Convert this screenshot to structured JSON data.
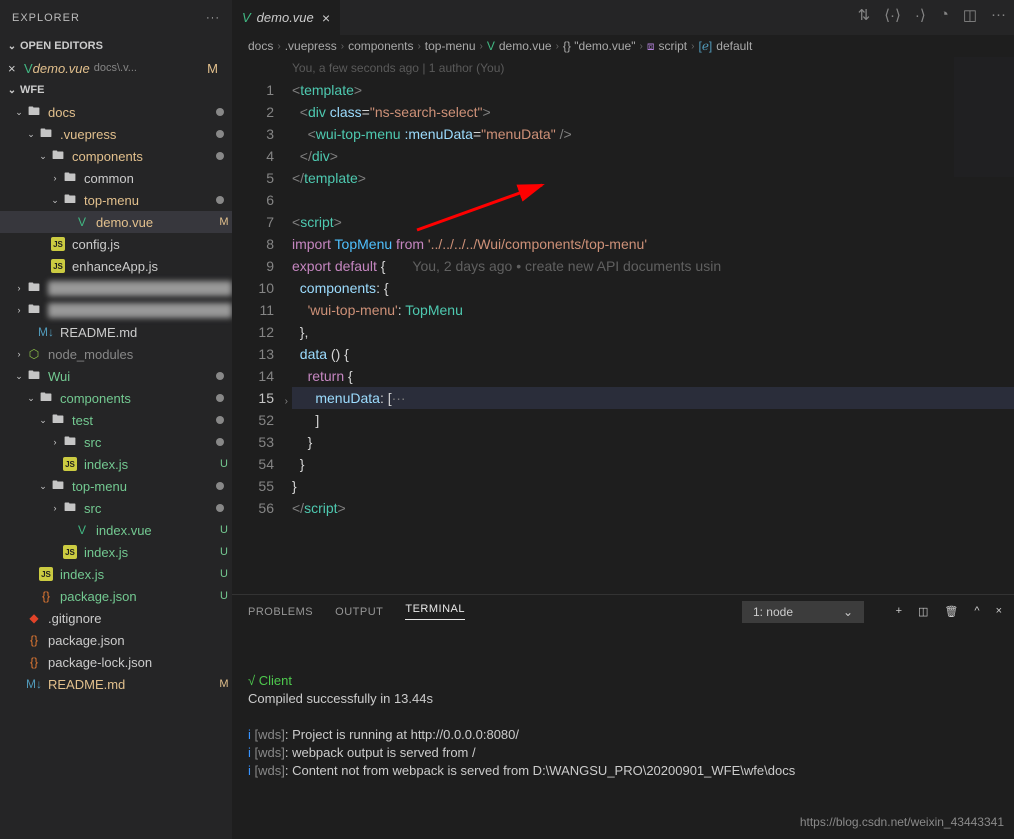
{
  "explorer": {
    "title": "EXPLORER",
    "open_editors_label": "OPEN EDITORS",
    "workspace_label": "WFE",
    "open_file": {
      "name": "demo.vue",
      "path": "docs\\.v...",
      "badge": "M"
    }
  },
  "tree": [
    {
      "depth": 1,
      "type": "folder",
      "open": true,
      "name": "docs",
      "dot": true,
      "textClass": "modified-text"
    },
    {
      "depth": 2,
      "type": "folder",
      "open": true,
      "name": ".vuepress",
      "dot": true,
      "textClass": "modified-text"
    },
    {
      "depth": 3,
      "type": "folder",
      "open": true,
      "name": "components",
      "dot": true,
      "textClass": "modified-text"
    },
    {
      "depth": 4,
      "type": "folder",
      "open": false,
      "name": "common"
    },
    {
      "depth": 4,
      "type": "folder",
      "open": true,
      "name": "top-menu",
      "dot": true,
      "textClass": "modified-text"
    },
    {
      "depth": 5,
      "type": "file",
      "icon": "vue",
      "name": "demo.vue",
      "badge": "M",
      "badgeClass": "git-m",
      "active": true,
      "textClass": "modified-text"
    },
    {
      "depth": 3,
      "type": "file",
      "icon": "js",
      "name": "config.js"
    },
    {
      "depth": 3,
      "type": "file",
      "icon": "js",
      "name": "enhanceApp.js"
    },
    {
      "depth": 1,
      "type": "folder",
      "open": false,
      "name": "blurred1",
      "blurred": true
    },
    {
      "depth": 1,
      "type": "folder",
      "open": false,
      "name": "blurred2",
      "blurred": true
    },
    {
      "depth": 2,
      "type": "file",
      "icon": "md",
      "name": "README.md"
    },
    {
      "depth": 1,
      "type": "folder",
      "open": false,
      "name": "node_modules",
      "icon": "nm",
      "textClass": "t-gray"
    },
    {
      "depth": 1,
      "type": "folder",
      "open": true,
      "name": "Wui",
      "dot": true,
      "textClass": "git-text"
    },
    {
      "depth": 2,
      "type": "folder",
      "open": true,
      "name": "components",
      "dot": true,
      "textClass": "git-text"
    },
    {
      "depth": 3,
      "type": "folder",
      "open": true,
      "name": "test",
      "dot": true,
      "textClass": "git-text"
    },
    {
      "depth": 4,
      "type": "folder",
      "open": false,
      "name": "src",
      "dot": true,
      "textClass": "git-text"
    },
    {
      "depth": 4,
      "type": "file",
      "icon": "js",
      "name": "index.js",
      "badge": "U",
      "badgeClass": "git-u",
      "textClass": "git-text"
    },
    {
      "depth": 3,
      "type": "folder",
      "open": true,
      "name": "top-menu",
      "dot": true,
      "textClass": "git-text"
    },
    {
      "depth": 4,
      "type": "folder",
      "open": false,
      "name": "src",
      "dot": true,
      "textClass": "git-text"
    },
    {
      "depth": 5,
      "type": "file",
      "icon": "vue",
      "name": "index.vue",
      "badge": "U",
      "badgeClass": "git-u",
      "textClass": "git-text"
    },
    {
      "depth": 4,
      "type": "file",
      "icon": "js",
      "name": "index.js",
      "badge": "U",
      "badgeClass": "git-u",
      "textClass": "git-text"
    },
    {
      "depth": 2,
      "type": "file",
      "icon": "js",
      "name": "index.js",
      "badge": "U",
      "badgeClass": "git-u",
      "textClass": "git-text"
    },
    {
      "depth": 2,
      "type": "file",
      "icon": "json",
      "name": "package.json",
      "badge": "U",
      "badgeClass": "git-u",
      "textClass": "git-text"
    },
    {
      "depth": 1,
      "type": "file",
      "icon": "git",
      "name": ".gitignore"
    },
    {
      "depth": 1,
      "type": "file",
      "icon": "json",
      "name": "package.json"
    },
    {
      "depth": 1,
      "type": "file",
      "icon": "json",
      "name": "package-lock.json"
    },
    {
      "depth": 1,
      "type": "file",
      "icon": "md",
      "name": "README.md",
      "badge": "M",
      "badgeClass": "git-m",
      "textClass": "modified-text"
    }
  ],
  "tab": {
    "name": "demo.vue"
  },
  "breadcrumb": [
    "docs",
    ".vuepress",
    "components",
    "top-menu",
    "demo.vue",
    "{} \"demo.vue\"",
    "script",
    "default"
  ],
  "blame_header": "You, a few seconds ago | 1 author (You)",
  "inline_blame": "You, 2 days ago • create new API documents usin",
  "code_lines": [
    {
      "n": 1,
      "html": "<span class='tk-tag'>&lt;</span><span class='tk-name'>template</span><span class='tk-tag'>&gt;</span>"
    },
    {
      "n": 2,
      "html": "  <span class='tk-tag'>&lt;</span><span class='tk-name'>div</span> <span class='tk-attr'>class</span><span class='tk-punc'>=</span><span class='tk-str'>\"ns-search-select\"</span><span class='tk-tag'>&gt;</span>"
    },
    {
      "n": 3,
      "html": "    <span class='tk-tag'>&lt;</span><span class='tk-name'>wui-top-menu</span> <span class='tk-attr'>:menuData</span><span class='tk-punc'>=</span><span class='tk-str'>\"menuData\"</span> <span class='tk-tag'>/&gt;</span>"
    },
    {
      "n": 4,
      "html": "  <span class='tk-tag'>&lt;/</span><span class='tk-name'>div</span><span class='tk-tag'>&gt;</span>"
    },
    {
      "n": 5,
      "html": "<span class='tk-tag'>&lt;/</span><span class='tk-name'>template</span><span class='tk-tag'>&gt;</span>"
    },
    {
      "n": 6,
      "html": ""
    },
    {
      "n": 7,
      "html": "<span class='tk-tag'>&lt;</span><span class='tk-name'>script</span><span class='tk-tag'>&gt;</span>"
    },
    {
      "n": 8,
      "html": "<span class='tk-kw'>import</span> <span class='tk-var'>TopMenu</span> <span class='tk-kw'>from</span> <span class='tk-str'>'../../../../Wui/components/top-menu'</span>",
      "mod": true
    },
    {
      "n": 9,
      "html": "<span class='tk-kw'>export</span> <span class='tk-kw'>default</span> <span class='tk-punc'>{</span>       <span class='tk-blame'>{{BLAME}}</span>"
    },
    {
      "n": 10,
      "html": "  <span class='tk-prop'>components</span><span class='tk-punc'>: {</span>"
    },
    {
      "n": 11,
      "html": "    <span class='tk-str'>'wui-top-menu'</span><span class='tk-punc'>:</span> <span class='tk-type'>TopMenu</span>"
    },
    {
      "n": 12,
      "html": "  <span class='tk-punc'>},</span>"
    },
    {
      "n": 13,
      "html": "  <span class='tk-prop'>data</span> <span class='tk-punc'>() {</span>"
    },
    {
      "n": 14,
      "html": "    <span class='tk-kw'>return</span> <span class='tk-punc'>{</span>"
    },
    {
      "n": 15,
      "html": "      <span class='tk-prop'>menuData</span><span class='tk-punc'>: [</span><span class='tk-tag'>···</span>",
      "hl": true,
      "fold": true
    },
    {
      "n": 52,
      "html": "      <span class='tk-punc'>]</span>"
    },
    {
      "n": 53,
      "html": "    <span class='tk-punc'>}</span>"
    },
    {
      "n": 54,
      "html": "  <span class='tk-punc'>}</span>"
    },
    {
      "n": 55,
      "html": "<span class='tk-punc'>}</span>"
    },
    {
      "n": 56,
      "html": "<span class='tk-tag'>&lt;/</span><span class='tk-name'>script</span><span class='tk-tag'>&gt;</span>"
    }
  ],
  "panel": {
    "tabs": [
      "PROBLEMS",
      "OUTPUT",
      "TERMINAL"
    ],
    "active_tab": "TERMINAL",
    "select": "1: node"
  },
  "terminal_lines": [
    {
      "html": "<span class='t-green'>√</span> <span class='t-green'>Client</span>"
    },
    {
      "html": "  Compiled successfully in 13.44s"
    },
    {
      "html": ""
    },
    {
      "html": "<span class='t-cyan'>i</span> <span class='t-gray'>[wds]</span>: Project is running at http://0.0.0.0:8080/"
    },
    {
      "html": "<span class='t-cyan'>i</span> <span class='t-gray'>[wds]</span>: webpack output is served from /"
    },
    {
      "html": "<span class='t-cyan'>i</span> <span class='t-gray'>[wds]</span>: Content not from webpack is served from D:\\WANGSU_PRO\\20200901_WFE\\wfe\\docs"
    }
  ],
  "watermark": "https://blog.csdn.net/weixin_43443341"
}
